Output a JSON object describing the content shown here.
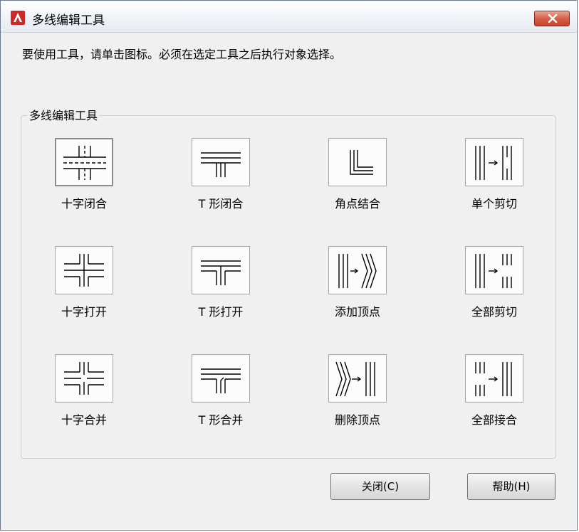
{
  "window": {
    "title": "多线编辑工具",
    "accent": "#cc2a2a"
  },
  "instruction": "要使用工具，请单击图标。必须在选定工具之后执行对象选择。",
  "group": {
    "label": "多线编辑工具",
    "tools": [
      {
        "id": "cross-close",
        "label": "十字闭合",
        "icon": "cross-closed-icon"
      },
      {
        "id": "tee-close",
        "label": "T 形闭合",
        "icon": "tee-closed-icon"
      },
      {
        "id": "corner-joint",
        "label": "角点结合",
        "icon": "corner-joint-icon"
      },
      {
        "id": "cut-single",
        "label": "单个剪切",
        "icon": "cut-single-icon"
      },
      {
        "id": "cross-open",
        "label": "十字打开",
        "icon": "cross-open-icon"
      },
      {
        "id": "tee-open",
        "label": "T 形打开",
        "icon": "tee-open-icon"
      },
      {
        "id": "add-vertex",
        "label": "添加顶点",
        "icon": "add-vertex-icon"
      },
      {
        "id": "cut-all",
        "label": "全部剪切",
        "icon": "cut-all-icon"
      },
      {
        "id": "cross-merge",
        "label": "十字合并",
        "icon": "cross-merged-icon"
      },
      {
        "id": "tee-merge",
        "label": "T 形合并",
        "icon": "tee-merged-icon"
      },
      {
        "id": "delete-vertex",
        "label": "删除顶点",
        "icon": "delete-vertex-icon"
      },
      {
        "id": "weld-all",
        "label": "全部接合",
        "icon": "weld-all-icon"
      }
    ]
  },
  "buttons": {
    "close": "关闭(C)",
    "help": "帮助(H)"
  }
}
